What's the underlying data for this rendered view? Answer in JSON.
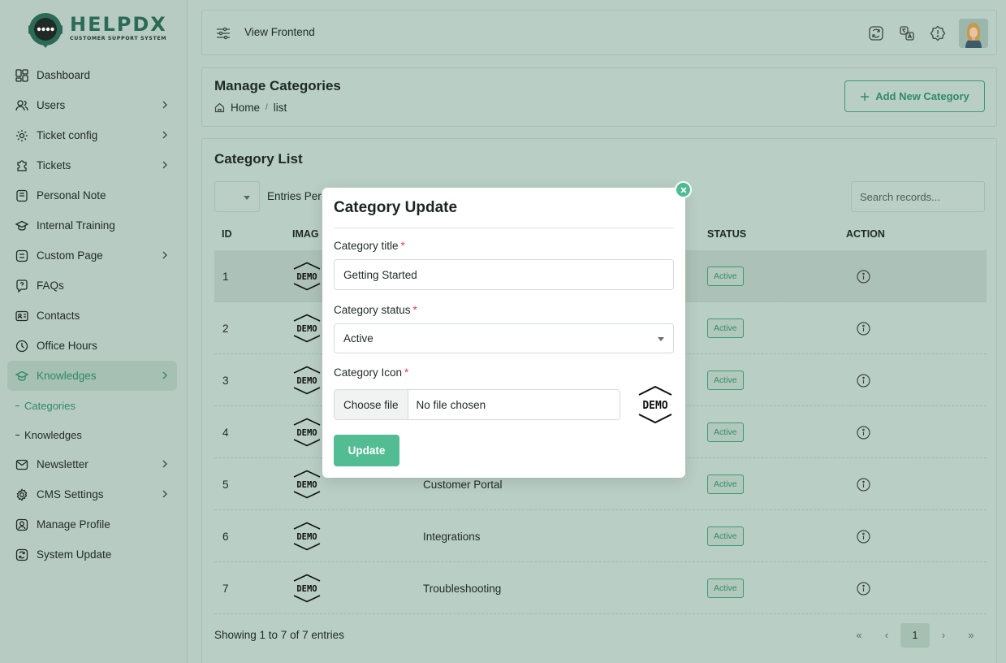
{
  "brand": {
    "name": "HELPDX",
    "tagline": "CUSTOMER SUPPORT SYSTEM",
    "accent": "#2c8a68",
    "button_green": "#52bd92"
  },
  "sidebar": {
    "items": [
      {
        "label": "Dashboard",
        "icon": "dashboard-icon",
        "has_children": false
      },
      {
        "label": "Users",
        "icon": "users-icon",
        "has_children": true
      },
      {
        "label": "Ticket config",
        "icon": "ticket-config-icon",
        "has_children": true
      },
      {
        "label": "Tickets",
        "icon": "tickets-icon",
        "has_children": true
      },
      {
        "label": "Personal Note",
        "icon": "note-icon",
        "has_children": false
      },
      {
        "label": "Internal Training",
        "icon": "training-icon",
        "has_children": false
      },
      {
        "label": "Custom Page",
        "icon": "custom-page-icon",
        "has_children": true
      },
      {
        "label": "FAQs",
        "icon": "faq-icon",
        "has_children": false
      },
      {
        "label": "Contacts",
        "icon": "contacts-icon",
        "has_children": false
      },
      {
        "label": "Office Hours",
        "icon": "clock-icon",
        "has_children": false
      },
      {
        "label": "Knowledges",
        "icon": "knowledge-icon",
        "has_children": true,
        "active": true
      },
      {
        "label": "Newsletter",
        "icon": "newsletter-icon",
        "has_children": true
      },
      {
        "label": "CMS Settings",
        "icon": "settings-icon",
        "has_children": true
      },
      {
        "label": "Manage Profile",
        "icon": "profile-icon",
        "has_children": false
      },
      {
        "label": "System Update",
        "icon": "update-icon",
        "has_children": false
      }
    ],
    "sub_items": [
      {
        "label": "Categories",
        "active": true
      },
      {
        "label": "Knowledges",
        "active": false
      }
    ]
  },
  "topbar": {
    "view_frontend": "View Frontend"
  },
  "page": {
    "title": "Manage Categories",
    "breadcrumb": {
      "home": "Home",
      "current": "list"
    },
    "add_button": "Add New Category"
  },
  "list": {
    "title": "Category List",
    "entries_label": "Entries Per",
    "search_placeholder": "Search records...",
    "columns": {
      "id": "ID",
      "image": "IMAG",
      "status": "STATUS",
      "action": "ACTION"
    },
    "rows": [
      {
        "id": "1",
        "name": "",
        "status": "Active"
      },
      {
        "id": "2",
        "name": "",
        "status": "Active"
      },
      {
        "id": "3",
        "name": "",
        "status": "Active"
      },
      {
        "id": "4",
        "name": "",
        "status": "Active"
      },
      {
        "id": "5",
        "name": "Customer Portal",
        "status": "Active"
      },
      {
        "id": "6",
        "name": "Integrations",
        "status": "Active"
      },
      {
        "id": "7",
        "name": "Troubleshooting",
        "status": "Active"
      }
    ],
    "image_text": "DEMO",
    "showing": "Showing 1 to 7 of 7 entries",
    "pager": {
      "first": "«",
      "prev": "‹",
      "current": "1",
      "next": "›",
      "last": "»"
    }
  },
  "modal": {
    "title": "Category Update",
    "title_label": "Category title",
    "title_value": "Getting Started",
    "status_label": "Category status",
    "status_value": "Active",
    "icon_label": "Category Icon",
    "choose_file": "Choose file",
    "no_file": "No file chosen",
    "preview_text": "DEMO",
    "required_mark": "*",
    "update_button": "Update"
  }
}
